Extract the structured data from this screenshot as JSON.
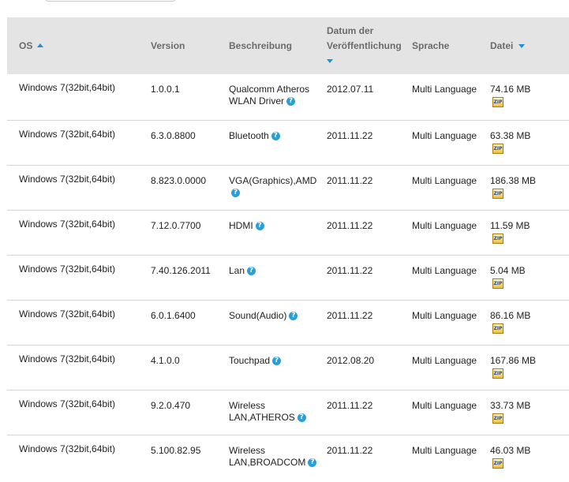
{
  "header": {
    "os": "OS",
    "version": "Version",
    "description": "Beschreibung",
    "release_date_line1": "Datum der",
    "release_date_line2": "Veröffentlichung",
    "language": "Sprache",
    "file": "Datei"
  },
  "help_glyph": "?",
  "zip_label": "ZIP",
  "colors": {
    "header_bg": "#e4e4e4",
    "header_text": "#6b6b6b",
    "accent": "#1e90d8",
    "row_border": "#d4d4d4"
  },
  "rows": [
    {
      "os": "Windows 7(32bit,64bit)",
      "version": "1.0.0.1",
      "desc1": "Qualcomm Atheros",
      "desc2": "WLAN Driver",
      "date": "2012.07.11",
      "lang": "Multi Language",
      "size": "74.16 MB"
    },
    {
      "os": "Windows 7(32bit,64bit)",
      "version": "6.3.0.8800",
      "desc1": "Bluetooth",
      "date": "2011.11.22",
      "lang": "Multi Language",
      "size": "63.38 MB"
    },
    {
      "os": "Windows 7(32bit,64bit)",
      "version": "8.823.0.0000",
      "desc1": "VGA(Graphics),AMD",
      "date": "2011.11.22",
      "lang": "Multi Language",
      "size": "186.38 MB"
    },
    {
      "os": "Windows 7(32bit,64bit)",
      "version": "7.12.0.7700",
      "desc1": "HDMI",
      "date": "2011.11.22",
      "lang": "Multi Language",
      "size": "11.59 MB"
    },
    {
      "os": "Windows 7(32bit,64bit)",
      "version": "7.40.126.2011",
      "desc1": "Lan",
      "date": "2011.11.22",
      "lang": "Multi Language",
      "size": "5.04 MB"
    },
    {
      "os": "Windows 7(32bit,64bit)",
      "version": "6.0.1.6400",
      "desc1": "Sound(Audio)",
      "date": "2011.11.22",
      "lang": "Multi Language",
      "size": "86.16 MB"
    },
    {
      "os": "Windows 7(32bit,64bit)",
      "version": "4.1.0.0",
      "desc1": "Touchpad",
      "date": "2012.08.20",
      "lang": "Multi Language",
      "size": "167.86 MB"
    },
    {
      "os": "Windows 7(32bit,64bit)",
      "version": "9.2.0.470",
      "desc1": "Wireless",
      "desc2": "LAN,ATHEROS",
      "date": "2011.11.22",
      "lang": "Multi Language",
      "size": "33.73 MB"
    },
    {
      "os": "Windows 7(32bit,64bit)",
      "version": "5.100.82.95",
      "desc1": "Wireless",
      "desc2": "LAN,BROADCOM",
      "date": "2011.11.22",
      "lang": "Multi Language",
      "size": "46.03 MB"
    }
  ]
}
